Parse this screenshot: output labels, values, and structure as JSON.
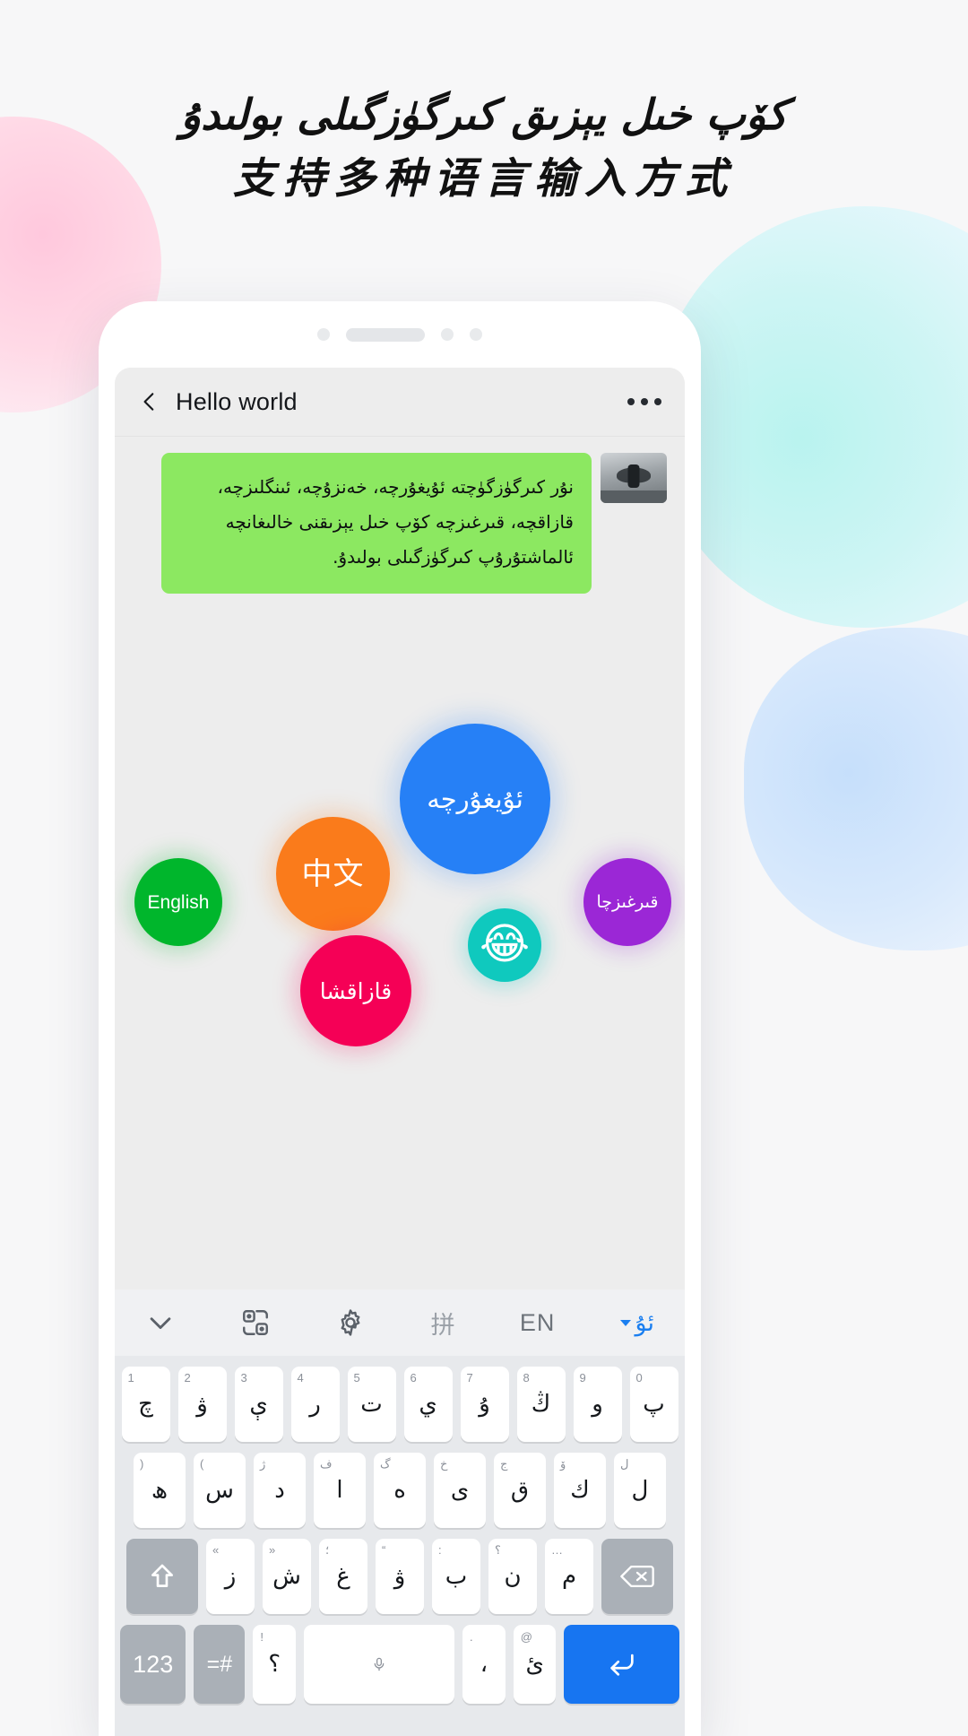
{
  "headline": {
    "uyghur": "كۆپ خىل يېزىق كىرگۈزگىلى بولىدۇ",
    "chinese": "支持多种语言输入方式"
  },
  "phone": {
    "chat": {
      "back_icon": "chevron-left-icon",
      "title": "Hello world",
      "more_icon": "more-options-icon",
      "message": "نۇر كىرگۈزگۈچتە ئۇيغۇرچە، خەنزۇچە، ئىنگلىزچە، قازاقچە، قىرغىزچە كۆپ خىل يېزىقنى خالىغانچە ئالماشتۇرۇپ كىرگۈزگىلى بولىدۇ.",
      "bubble_color": "#8ce861",
      "avatar": "user-avatar"
    },
    "language_bubbles": [
      {
        "name": "uyghur",
        "label": "ئۇيغۇرچە",
        "color": "#2680f6"
      },
      {
        "name": "chinese",
        "label": "中文",
        "color": "#fa7b1b"
      },
      {
        "name": "english",
        "label": "English",
        "color": "#00b62c"
      },
      {
        "name": "kyrgyz",
        "label": "قىرغىزچا",
        "color": "#9b27d6"
      },
      {
        "name": "kazakh",
        "label": "قازاقشا",
        "color": "#f50056"
      },
      {
        "name": "emoji",
        "label": "😂",
        "color": "#0fc9be"
      }
    ],
    "keyboard": {
      "toolbar": {
        "collapse_icon": "chevron-down-icon",
        "theme_icon": "theme-skin-icon",
        "settings_icon": "gear-icon",
        "pinyin_label": "拼",
        "english_label": "EN",
        "uyghur_label": "ئۇ"
      },
      "rows": [
        [
          {
            "hint": "1",
            "label": "چ"
          },
          {
            "hint": "2",
            "label": "ۋ"
          },
          {
            "hint": "3",
            "label": "ې"
          },
          {
            "hint": "4",
            "label": "ر"
          },
          {
            "hint": "5",
            "label": "ت"
          },
          {
            "hint": "6",
            "label": "ي"
          },
          {
            "hint": "7",
            "label": "ۇ"
          },
          {
            "hint": "8",
            "label": "ڭ"
          },
          {
            "hint": "9",
            "label": "و"
          },
          {
            "hint": "0",
            "label": "پ"
          }
        ],
        [
          {
            "hint": ")",
            "label": "ھ"
          },
          {
            "hint": "(",
            "label": "س"
          },
          {
            "hint": "ژ",
            "label": "د"
          },
          {
            "hint": "ف",
            "label": "ا"
          },
          {
            "hint": "گ",
            "label": "ە"
          },
          {
            "hint": "خ",
            "label": "ى"
          },
          {
            "hint": "ج",
            "label": "ق"
          },
          {
            "hint": "ۆ",
            "label": "ك"
          },
          {
            "hint": "ل",
            "label": "ل"
          }
        ],
        [
          {
            "hint": "",
            "label": "shift-icon",
            "fn": true
          },
          {
            "hint": "«",
            "label": "ز"
          },
          {
            "hint": "»",
            "label": "ش"
          },
          {
            "hint": "؛",
            "label": "غ"
          },
          {
            "hint": "“",
            "label": "ۋ"
          },
          {
            "hint": ":",
            "label": "ب"
          },
          {
            "hint": "؟",
            "label": "ن"
          },
          {
            "hint": "…",
            "label": "م"
          },
          {
            "hint": "",
            "label": "backspace-icon",
            "fn": true
          }
        ]
      ],
      "bottom_row": {
        "numbers_label": "123",
        "symbols_label": "=#",
        "question_hint": "!",
        "question_label": "؟",
        "space_icon": "microphone-icon",
        "comma_hint": ".",
        "comma_label": "،",
        "hamza_hint": "@",
        "hamza_label": "ئ",
        "enter_icon": "enter-return-icon",
        "enter_color": "#1775f1"
      }
    }
  }
}
